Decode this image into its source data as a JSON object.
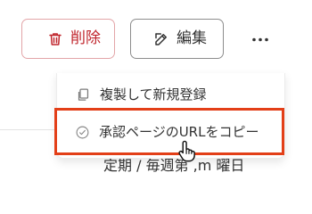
{
  "toolbar": {
    "delete_label": "削除",
    "edit_label": "編集",
    "more_icon": "ellipsis-icon"
  },
  "menu": {
    "items": [
      {
        "icon": "copy-icon",
        "label": "複製して新規登録"
      },
      {
        "icon": "check-circle-icon",
        "label": "承認ページのURLをコピー"
      }
    ]
  },
  "background": {
    "schedule_text": "定期 / 毎週第 ,m 曜日"
  },
  "colors": {
    "danger": "#c0262d",
    "danger_border": "#e3a5a8",
    "highlight": "#e33f18",
    "text": "#333333",
    "neutral_border": "#8d8d8d"
  }
}
